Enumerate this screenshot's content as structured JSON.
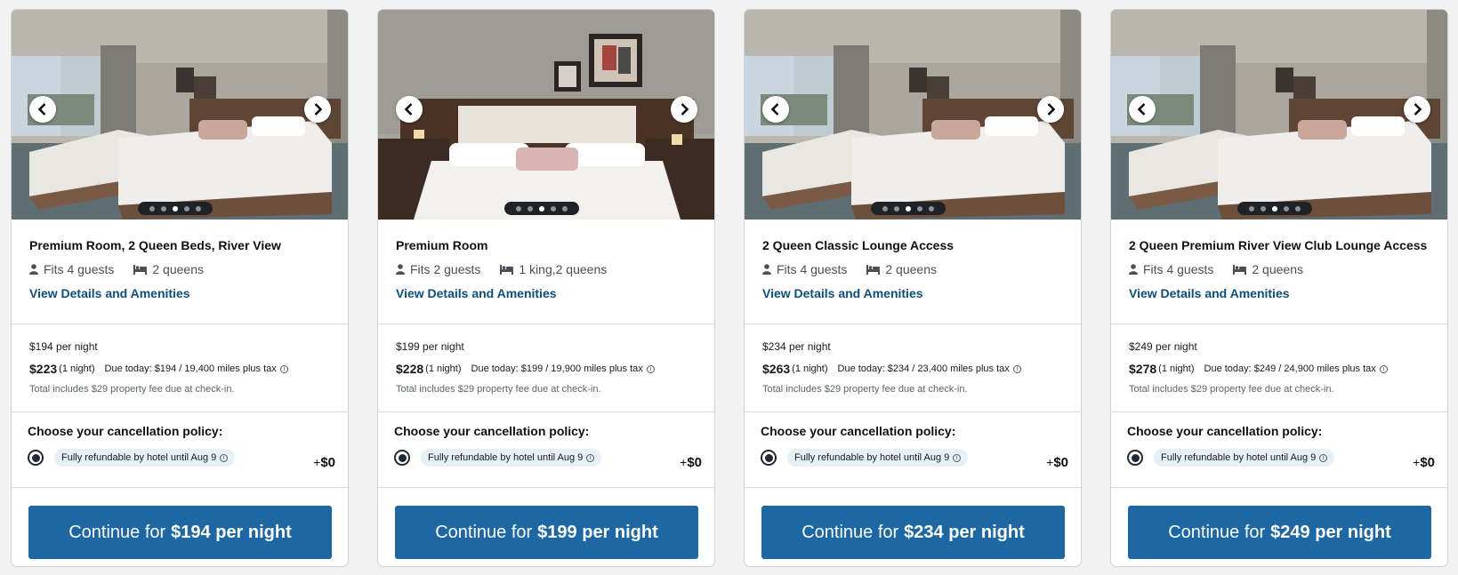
{
  "colors": {
    "primary_button": "#1d67a4",
    "link": "#0b4f7d",
    "policy_pill_bg": "#e6f1f7",
    "page_bg": "#f2f2f2"
  },
  "icons": {
    "prev": "chevron-left-icon",
    "next": "chevron-right-icon",
    "guests": "person-icon",
    "beds": "bed-icon",
    "info": "info-icon"
  },
  "cards": [
    {
      "photo": "two-queen",
      "room_name": "Premium Room, 2 Queen Beds, River View",
      "guests": "Fits 4 guests",
      "beds": "2 queens",
      "details_link": "View Details and Amenities",
      "per_night": "$194 per night",
      "total": "$223",
      "nights": "(1 night)",
      "due_today": "Due today: $194 / 19,400 miles plus tax",
      "fee_note": "Total includes $29 property fee due at check-in.",
      "policy_title": "Choose your cancellation policy:",
      "policy_label": "Fully refundable by hotel until Aug 9",
      "policy_plus": "+",
      "policy_price": "$0",
      "cta_prefix": "Continue for",
      "cta_amount": "$194 per night"
    },
    {
      "photo": "king",
      "room_name": "Premium Room",
      "guests": "Fits 2 guests",
      "beds": "1 king,2 queens",
      "details_link": "View Details and Amenities",
      "per_night": "$199 per night",
      "total": "$228",
      "nights": "(1 night)",
      "due_today": "Due today: $199 / 19,900 miles plus tax",
      "fee_note": "Total includes $29 property fee due at check-in.",
      "policy_title": "Choose your cancellation policy:",
      "policy_label": "Fully refundable by hotel until Aug 9",
      "policy_plus": "+",
      "policy_price": "$0",
      "cta_prefix": "Continue for",
      "cta_amount": "$199 per night"
    },
    {
      "photo": "two-queen",
      "room_name": "2 Queen Classic Lounge Access",
      "guests": "Fits 4 guests",
      "beds": "2 queens",
      "details_link": "View Details and Amenities",
      "per_night": "$234 per night",
      "total": "$263",
      "nights": "(1 night)",
      "due_today": "Due today: $234 / 23,400 miles plus tax",
      "fee_note": "Total includes $29 property fee due at check-in.",
      "policy_title": "Choose your cancellation policy:",
      "policy_label": "Fully refundable by hotel until Aug 9",
      "policy_plus": "+",
      "policy_price": "$0",
      "cta_prefix": "Continue for",
      "cta_amount": "$234 per night"
    },
    {
      "photo": "two-queen",
      "room_name": "2 Queen Premium River View Club Lounge Access",
      "guests": "Fits 4 guests",
      "beds": "2 queens",
      "details_link": "View Details and Amenities",
      "per_night": "$249 per night",
      "total": "$278",
      "nights": "(1 night)",
      "due_today": "Due today: $249 / 24,900 miles plus tax",
      "fee_note": "Total includes $29 property fee due at check-in.",
      "policy_title": "Choose your cancellation policy:",
      "policy_label": "Fully refundable by hotel until Aug 9",
      "policy_plus": "+",
      "policy_price": "$0",
      "cta_prefix": "Continue for",
      "cta_amount": "$249 per night"
    }
  ]
}
